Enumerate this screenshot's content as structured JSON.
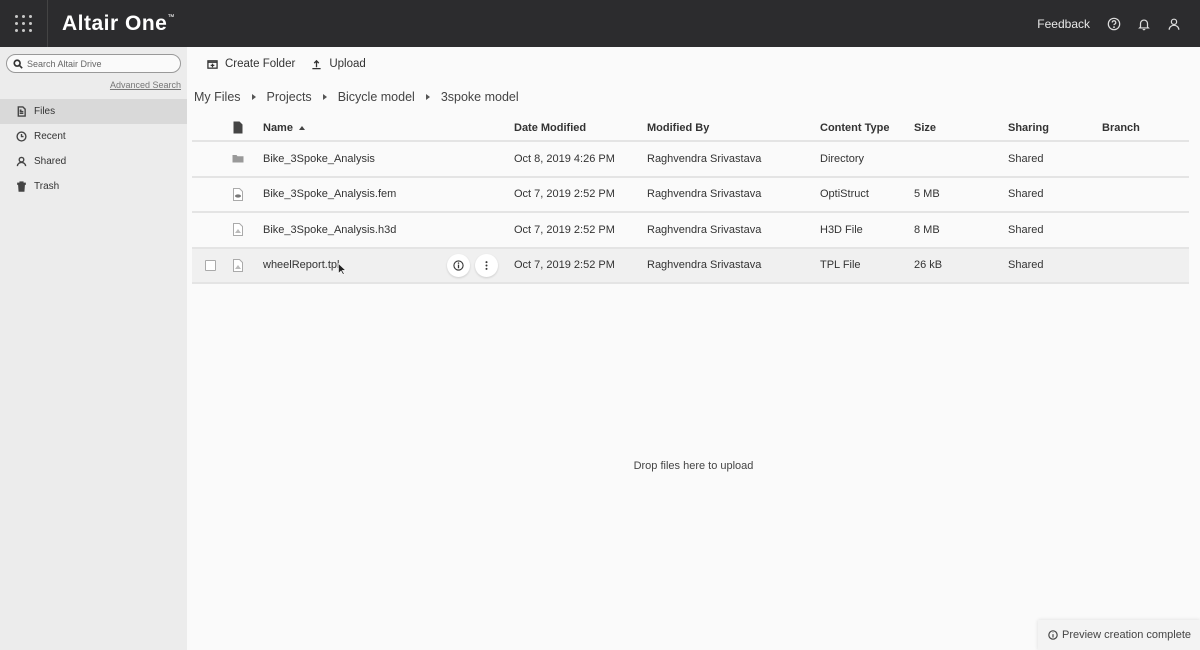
{
  "header": {
    "brand": "Altair One",
    "trademark": "™",
    "feedback_label": "Feedback",
    "icons": [
      "apps-grid-icon",
      "help-icon",
      "bell-icon",
      "user-icon"
    ]
  },
  "sidebar": {
    "search_placeholder": "Search Altair Drive",
    "advanced_search": "Advanced Search",
    "items": [
      {
        "label": "Files",
        "icon": "file-icon",
        "active": true
      },
      {
        "label": "Recent",
        "icon": "clock-icon",
        "active": false
      },
      {
        "label": "Shared",
        "icon": "user-icon",
        "active": false
      },
      {
        "label": "Trash",
        "icon": "trash-icon",
        "active": false
      }
    ]
  },
  "toolbar": {
    "create_folder": "Create Folder",
    "upload": "Upload"
  },
  "breadcrumb": [
    "My Files",
    "Projects",
    "Bicycle model",
    "3spoke model"
  ],
  "table": {
    "columns": {
      "name": "Name",
      "date": "Date Modified",
      "by": "Modified By",
      "type": "Content Type",
      "size": "Size",
      "sharing": "Sharing",
      "branch": "Branch"
    },
    "sort": {
      "column": "Name",
      "direction": "ascending"
    },
    "rows": [
      {
        "icon": "folder-icon",
        "name": "Bike_3Spoke_Analysis",
        "date": "Oct 8, 2019 4:26 PM",
        "by": "Raghvendra Srivastava",
        "type": "Directory",
        "size": "",
        "sharing": "Shared",
        "branch": ""
      },
      {
        "icon": "fem-file-icon",
        "name": "Bike_3Spoke_Analysis.fem",
        "date": "Oct 7, 2019 2:52 PM",
        "by": "Raghvendra Srivastava",
        "type": "OptiStruct",
        "size": "5 MB",
        "sharing": "Shared",
        "branch": ""
      },
      {
        "icon": "h3d-file-icon",
        "name": "Bike_3Spoke_Analysis.h3d",
        "date": "Oct 7, 2019 2:52 PM",
        "by": "Raghvendra Srivastava",
        "type": "H3D File",
        "size": "8 MB",
        "sharing": "Shared",
        "branch": ""
      },
      {
        "icon": "tpl-file-icon",
        "name": "wheelReport.tpl",
        "date": "Oct 7, 2019 2:52 PM",
        "by": "Raghvendra Srivastava",
        "type": "TPL File",
        "size": "26 kB",
        "sharing": "Shared",
        "branch": "",
        "hovered": true
      }
    ]
  },
  "drop_hint": "Drop files here to upload",
  "toast": "Preview creation complete"
}
